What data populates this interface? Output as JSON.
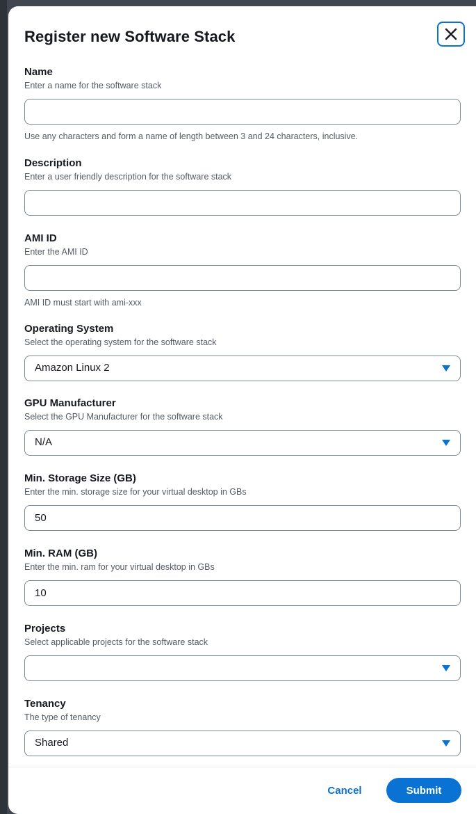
{
  "modal": {
    "title": "Register new Software Stack",
    "close_icon": "close-icon"
  },
  "fields": {
    "name": {
      "label": "Name",
      "description": "Enter a name for the software stack",
      "value": "",
      "help": "Use any characters and form a name of length between 3 and 24 characters, inclusive."
    },
    "description": {
      "label": "Description",
      "description": "Enter a user friendly description for the software stack",
      "value": ""
    },
    "ami_id": {
      "label": "AMI ID",
      "description": "Enter the AMI ID",
      "value": "",
      "help": "AMI ID must start with ami-xxx"
    },
    "operating_system": {
      "label": "Operating System",
      "description": "Select the operating system for the software stack",
      "selected": "Amazon Linux 2"
    },
    "gpu_manufacturer": {
      "label": "GPU Manufacturer",
      "description": "Select the GPU Manufacturer for the software stack",
      "selected": "N/A"
    },
    "min_storage": {
      "label": "Min. Storage Size (GB)",
      "description": "Enter the min. storage size for your virtual desktop in GBs",
      "value": "50"
    },
    "min_ram": {
      "label": "Min. RAM (GB)",
      "description": "Enter the min. ram for your virtual desktop in GBs",
      "value": "10"
    },
    "projects": {
      "label": "Projects",
      "description": "Select applicable projects for the software stack",
      "selected": ""
    },
    "tenancy": {
      "label": "Tenancy",
      "description": "The type of tenancy",
      "selected": "Shared"
    }
  },
  "footer": {
    "cancel_label": "Cancel",
    "submit_label": "Submit"
  },
  "colors": {
    "accent": "#0972d3",
    "text": "#16191f",
    "secondary_text": "#545b64",
    "border": "#7d8998"
  }
}
